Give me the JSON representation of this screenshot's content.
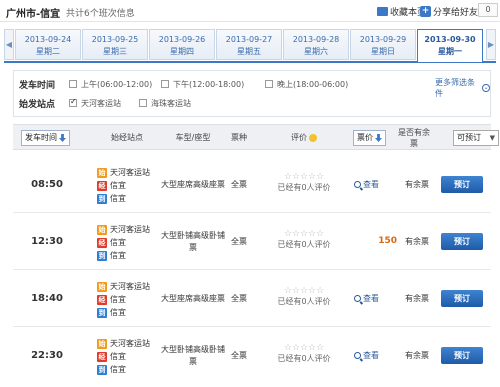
{
  "header": {
    "route": "广州市-信宜",
    "count": "共计6个班次信息",
    "favorite_label": "收藏本页",
    "share_label": "分享给好友",
    "share_count": "0"
  },
  "dates": [
    {
      "date": "2013-09-24",
      "weekday": "星期二"
    },
    {
      "date": "2013-09-25",
      "weekday": "星期三"
    },
    {
      "date": "2013-09-26",
      "weekday": "星期四"
    },
    {
      "date": "2013-09-27",
      "weekday": "星期五"
    },
    {
      "date": "2013-09-28",
      "weekday": "星期六"
    },
    {
      "date": "2013-09-29",
      "weekday": "星期日"
    },
    {
      "date": "2013-09-30",
      "weekday": "星期一"
    }
  ],
  "active_date_index": 6,
  "filters": {
    "time_label": "发车时间",
    "time_options": [
      "上午(06:00-12:00)",
      "下午(12:00-18:00)",
      "晚上(18:00-06:00)"
    ],
    "station_label": "始发站点",
    "station_options": [
      "天河客运站",
      "海珠客运站"
    ],
    "station_checked": [
      true,
      false
    ],
    "more_label": "更多筛选条件"
  },
  "table_header": {
    "depart_time": "发车时间",
    "stations": "始经站点",
    "bus_type": "车型/座型",
    "ticket_type": "票种",
    "rating": "评价",
    "price": "票价",
    "availability": "是否有余票",
    "bookable": "可预订"
  },
  "rows": [
    {
      "time": "08:50",
      "stations": [
        {
          "tag": "始",
          "name": "天河客运站"
        },
        {
          "tag": "经",
          "name": "信宜"
        },
        {
          "tag": "到",
          "name": "信宜"
        }
      ],
      "bus_type": "大型座席高级座票",
      "ticket": "全票",
      "rating_text": "已经有0人评价",
      "view": "查看",
      "price": "",
      "availability": "有余票",
      "book": "预订"
    },
    {
      "time": "12:30",
      "stations": [
        {
          "tag": "始",
          "name": "天河客运站"
        },
        {
          "tag": "经",
          "name": "信宜"
        },
        {
          "tag": "到",
          "name": "信宜"
        }
      ],
      "bus_type": "大型卧铺高级卧铺票",
      "ticket": "全票",
      "rating_text": "已经有0人评价",
      "view": "",
      "price": "150",
      "availability": "有余票",
      "book": "预订"
    },
    {
      "time": "18:40",
      "stations": [
        {
          "tag": "始",
          "name": "天河客运站"
        },
        {
          "tag": "经",
          "name": "信宜"
        },
        {
          "tag": "到",
          "name": "信宜"
        }
      ],
      "bus_type": "大型座席高级座票",
      "ticket": "全票",
      "rating_text": "已经有0人评价",
      "view": "查看",
      "price": "",
      "availability": "有余票",
      "book": "预订"
    },
    {
      "time": "22:30",
      "stations": [
        {
          "tag": "始",
          "name": "天河客运站"
        },
        {
          "tag": "经",
          "name": "信宜"
        },
        {
          "tag": "到",
          "name": "信宜"
        }
      ],
      "bus_type": "大型卧铺高级卧铺票",
      "ticket": "全票",
      "rating_text": "已经有0人评价",
      "view": "查看",
      "price": "",
      "availability": "有余票",
      "book": "预订"
    }
  ]
}
